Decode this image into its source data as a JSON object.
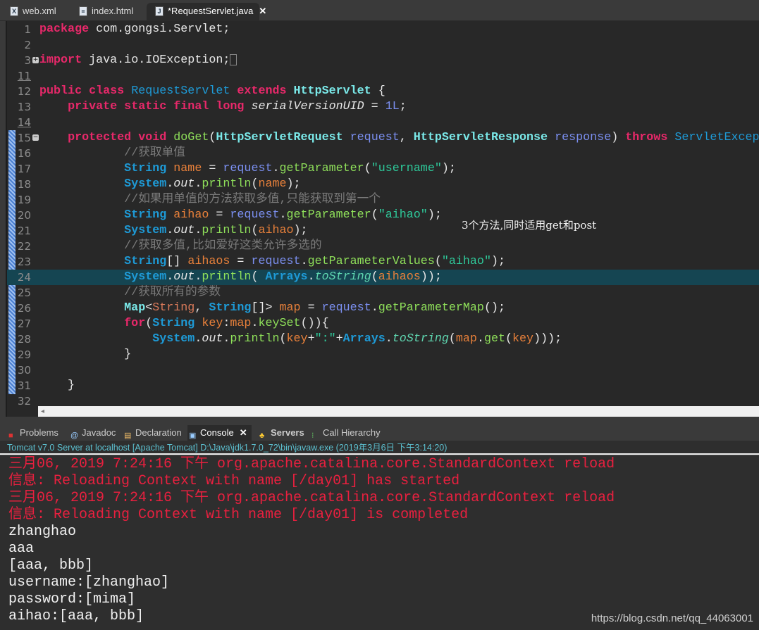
{
  "tabs": [
    {
      "label": "web.xml",
      "icon": "xml-file-icon"
    },
    {
      "label": "index.html",
      "icon": "html-file-icon"
    },
    {
      "label": "*RequestServlet.java",
      "icon": "java-file-icon",
      "active": true
    }
  ],
  "editor": {
    "highlighted_line": "24",
    "lines": [
      {
        "n": "1",
        "t": [
          [
            "kw",
            "package"
          ],
          [
            "p",
            " com.gongsi.Servlet;"
          ]
        ]
      },
      {
        "n": "2",
        "t": []
      },
      {
        "n": "3",
        "fold": "+",
        "t": [
          [
            "kw",
            "import"
          ],
          [
            "p",
            " java.io.IOException;"
          ]
        ],
        "collapsed": true
      },
      {
        "n": "11",
        "ul": true,
        "t": []
      },
      {
        "n": "12",
        "t": [
          [
            "kw",
            "public class "
          ],
          [
            "cls",
            "RequestServlet"
          ],
          [
            "kw",
            " extends "
          ],
          [
            "cls2",
            "HttpServlet"
          ],
          [
            "p",
            " {"
          ]
        ]
      },
      {
        "n": "13",
        "t": [
          [
            "p",
            "    "
          ],
          [
            "kw",
            "private static final long "
          ],
          [
            "fld",
            "serialVersionUID"
          ],
          [
            "p",
            " = "
          ],
          [
            "num",
            "1L"
          ],
          [
            "p",
            ";"
          ]
        ]
      },
      {
        "n": "14",
        "ul": true,
        "t": []
      },
      {
        "n": "15",
        "fold": "−",
        "t": [
          [
            "p",
            "    "
          ],
          [
            "kw",
            "protected void "
          ],
          [
            "mth",
            "doGet"
          ],
          [
            "p",
            "("
          ],
          [
            "cls2",
            "HttpServletRequest"
          ],
          [
            "param",
            " request"
          ],
          [
            "p",
            ", "
          ],
          [
            "cls2",
            "HttpServletResponse"
          ],
          [
            "param",
            " response"
          ],
          [
            "p",
            ") "
          ],
          [
            "kw",
            "throws "
          ],
          [
            "cls",
            "ServletException"
          ]
        ]
      },
      {
        "n": "16",
        "t": [
          [
            "cm",
            "            //获取单值"
          ]
        ]
      },
      {
        "n": "17",
        "t": [
          [
            "p",
            "            "
          ],
          [
            "type",
            "String"
          ],
          [
            "var",
            " name"
          ],
          [
            "p",
            " = "
          ],
          [
            "param",
            "request"
          ],
          [
            "p",
            "."
          ],
          [
            "mth",
            "getParameter"
          ],
          [
            "p",
            "("
          ],
          [
            "str",
            "\"username\""
          ],
          [
            "p",
            ");"
          ]
        ]
      },
      {
        "n": "18",
        "t": [
          [
            "p",
            "            "
          ],
          [
            "type",
            "System"
          ],
          [
            "p",
            "."
          ],
          [
            "fld",
            "out"
          ],
          [
            "p",
            "."
          ],
          [
            "mth",
            "println"
          ],
          [
            "p",
            "("
          ],
          [
            "var",
            "name"
          ],
          [
            "p",
            ");"
          ]
        ]
      },
      {
        "n": "19",
        "t": [
          [
            "cm",
            "            //如果用单值的方法获取多值,只能获取到第一个"
          ]
        ]
      },
      {
        "n": "20",
        "t": [
          [
            "p",
            "            "
          ],
          [
            "type",
            "String"
          ],
          [
            "var",
            " aihao"
          ],
          [
            "p",
            " = "
          ],
          [
            "param",
            "request"
          ],
          [
            "p",
            "."
          ],
          [
            "mth",
            "getParameter"
          ],
          [
            "p",
            "("
          ],
          [
            "str",
            "\"aihao\""
          ],
          [
            "p",
            ");"
          ]
        ]
      },
      {
        "n": "21",
        "t": [
          [
            "p",
            "            "
          ],
          [
            "type",
            "System"
          ],
          [
            "p",
            "."
          ],
          [
            "fld",
            "out"
          ],
          [
            "p",
            "."
          ],
          [
            "mth",
            "println"
          ],
          [
            "p",
            "("
          ],
          [
            "var",
            "aihao"
          ],
          [
            "p",
            ");"
          ]
        ]
      },
      {
        "n": "22",
        "t": [
          [
            "cm",
            "            //获取多值,比如爱好这类允许多选的"
          ]
        ]
      },
      {
        "n": "23",
        "t": [
          [
            "p",
            "            "
          ],
          [
            "type",
            "String"
          ],
          [
            "p",
            "[] "
          ],
          [
            "var",
            "aihaos"
          ],
          [
            "p",
            " = "
          ],
          [
            "param",
            "request"
          ],
          [
            "p",
            "."
          ],
          [
            "mth",
            "getParameterValues"
          ],
          [
            "p",
            "("
          ],
          [
            "str",
            "\"aihao\""
          ],
          [
            "p",
            ");"
          ]
        ]
      },
      {
        "n": "24",
        "t": [
          [
            "p",
            "            "
          ],
          [
            "type",
            "System"
          ],
          [
            "p",
            "."
          ],
          [
            "fld",
            "out"
          ],
          [
            "p",
            "."
          ],
          [
            "mth",
            "println"
          ],
          [
            "p",
            "( "
          ],
          [
            "type",
            "Arrays"
          ],
          [
            "p",
            "."
          ],
          [
            "ital",
            "toString"
          ],
          [
            "p",
            "("
          ],
          [
            "var",
            "aihaos"
          ],
          [
            "p",
            "));"
          ]
        ]
      },
      {
        "n": "25",
        "t": [
          [
            "cm",
            "            //获取所有的参数"
          ]
        ]
      },
      {
        "n": "26",
        "t": [
          [
            "p",
            "            "
          ],
          [
            "cls2",
            "Map"
          ],
          [
            "p",
            "<"
          ],
          [
            "tw",
            "String"
          ],
          [
            "p",
            ", "
          ],
          [
            "type",
            "String"
          ],
          [
            "p",
            "[]> "
          ],
          [
            "var",
            "map"
          ],
          [
            "p",
            " = "
          ],
          [
            "param",
            "request"
          ],
          [
            "p",
            "."
          ],
          [
            "mth",
            "getParameterMap"
          ],
          [
            "p",
            "();"
          ]
        ]
      },
      {
        "n": "27",
        "t": [
          [
            "p",
            "            "
          ],
          [
            "kw",
            "for"
          ],
          [
            "p",
            "("
          ],
          [
            "type",
            "String"
          ],
          [
            "var",
            " key"
          ],
          [
            "p",
            ":"
          ],
          [
            "var",
            "map"
          ],
          [
            "p",
            "."
          ],
          [
            "mth",
            "keySet"
          ],
          [
            "p",
            "()){"
          ]
        ]
      },
      {
        "n": "28",
        "t": [
          [
            "p",
            "                "
          ],
          [
            "type",
            "System"
          ],
          [
            "p",
            "."
          ],
          [
            "fld",
            "out"
          ],
          [
            "p",
            "."
          ],
          [
            "mth",
            "println"
          ],
          [
            "p",
            "("
          ],
          [
            "var",
            "key"
          ],
          [
            "p",
            "+"
          ],
          [
            "str",
            "\":\""
          ],
          [
            "p",
            "+"
          ],
          [
            "type",
            "Arrays"
          ],
          [
            "p",
            "."
          ],
          [
            "ital",
            "toString"
          ],
          [
            "p",
            "("
          ],
          [
            "var",
            "map"
          ],
          [
            "p",
            "."
          ],
          [
            "mth",
            "get"
          ],
          [
            "p",
            "("
          ],
          [
            "var",
            "key"
          ],
          [
            "p",
            ")));"
          ]
        ]
      },
      {
        "n": "29",
        "t": [
          [
            "p",
            "            }"
          ]
        ]
      },
      {
        "n": "30",
        "t": []
      },
      {
        "n": "31",
        "t": [
          [
            "p",
            "    }"
          ]
        ]
      },
      {
        "n": "32",
        "t": []
      }
    ]
  },
  "annotation": "3个方法,同时适用get和post",
  "panel": {
    "tabs": [
      {
        "label": "Problems",
        "icon": "problems-icon"
      },
      {
        "label": "Javadoc",
        "icon": "at-icon"
      },
      {
        "label": "Declaration",
        "icon": "declaration-icon"
      },
      {
        "label": "Console",
        "icon": "console-icon",
        "active": true
      },
      {
        "label": "Servers",
        "icon": "servers-icon"
      },
      {
        "label": "Call Hierarchy",
        "icon": "call-hierarchy-icon"
      }
    ],
    "header": "Tomcat v7.0 Server at localhost [Apache Tomcat] D:\\Java\\jdk1.7.0_72\\bin\\javaw.exe (2019年3月6日 下午3:14:20)",
    "console": [
      {
        "err": true,
        "text": "三月06, 2019 7:24:16 下午 org.apache.catalina.core.StandardContext reload"
      },
      {
        "err": true,
        "text": "信息: Reloading Context with name [/day01] has started"
      },
      {
        "err": true,
        "text": "三月06, 2019 7:24:16 下午 org.apache.catalina.core.StandardContext reload"
      },
      {
        "err": true,
        "text": "信息: Reloading Context with name [/day01] is completed"
      },
      {
        "text": "zhanghao"
      },
      {
        "text": "aaa"
      },
      {
        "text": "[aaa, bbb]"
      },
      {
        "text": "username:[zhanghao]"
      },
      {
        "text": "password:[mima]"
      },
      {
        "text": "aihao:[aaa, bbb]"
      }
    ]
  },
  "watermark": "https://blog.csdn.net/qq_44063001",
  "colors": {
    "keyword": "#e8286a",
    "type": "#1e9ad6",
    "string": "#2ec99a",
    "comment": "#7a7a7a",
    "error": "#e8203f",
    "highlight": "#154552"
  }
}
